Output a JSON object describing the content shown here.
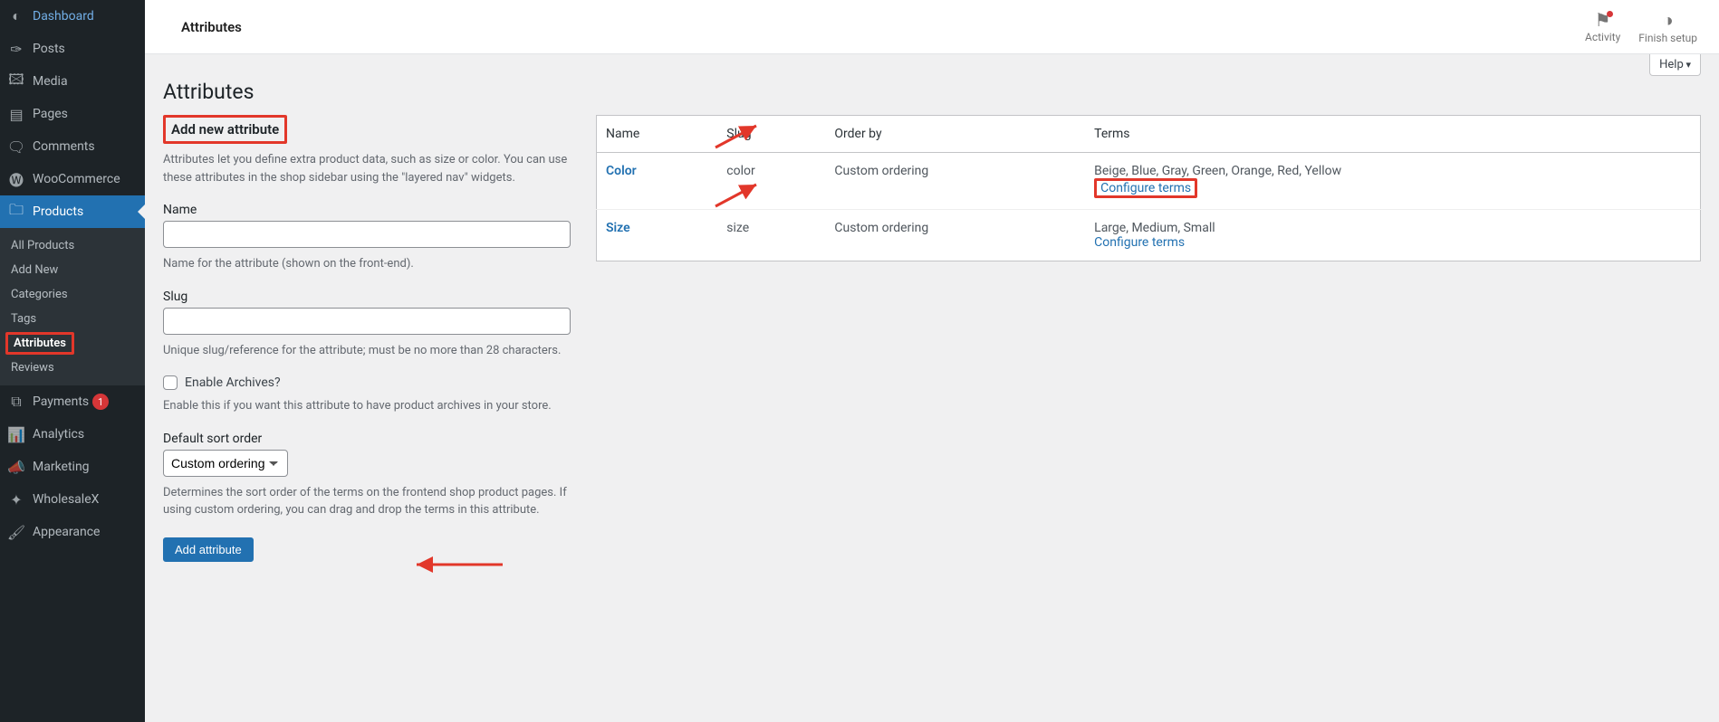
{
  "sidebar": {
    "items": [
      {
        "label": "Dashboard",
        "icon": "◐"
      },
      {
        "label": "Posts",
        "icon": "✑"
      },
      {
        "label": "Media",
        "icon": "🖾"
      },
      {
        "label": "Pages",
        "icon": "▤"
      },
      {
        "label": "Comments",
        "icon": "🗨"
      },
      {
        "label": "WooCommerce",
        "icon": "🅦"
      },
      {
        "label": "Products",
        "icon": "🗀",
        "current": true
      },
      {
        "label": "Payments",
        "icon": "⧉",
        "badge": "1"
      },
      {
        "label": "Analytics",
        "icon": "📊"
      },
      {
        "label": "Marketing",
        "icon": "📣"
      },
      {
        "label": "WholesaleX",
        "icon": "✦"
      },
      {
        "label": "Appearance",
        "icon": "🖌"
      }
    ],
    "submenu": [
      {
        "label": "All Products"
      },
      {
        "label": "Add New"
      },
      {
        "label": "Categories"
      },
      {
        "label": "Tags"
      },
      {
        "label": "Attributes",
        "active": true
      },
      {
        "label": "Reviews"
      }
    ]
  },
  "topbar": {
    "title": "Attributes",
    "activity": "Activity",
    "finish": "Finish setup"
  },
  "page": {
    "help": "Help",
    "heading": "Attributes",
    "add_heading": "Add new attribute",
    "intro": "Attributes let you define extra product data, such as size or color. You can use these attributes in the shop sidebar using the \"layered nav\" widgets.",
    "name_label": "Name",
    "name_help": "Name for the attribute (shown on the front-end).",
    "slug_label": "Slug",
    "slug_help": "Unique slug/reference for the attribute; must be no more than 28 characters.",
    "archives_label": "Enable Archives?",
    "archives_help": "Enable this if you want this attribute to have product archives in your store.",
    "sort_label": "Default sort order",
    "sort_value": "Custom ordering",
    "sort_help": "Determines the sort order of the terms on the frontend shop product pages. If using custom ordering, you can drag and drop the terms in this attribute.",
    "add_btn": "Add attribute"
  },
  "table": {
    "headers": {
      "name": "Name",
      "slug": "Slug",
      "order": "Order by",
      "terms": "Terms"
    },
    "configure": "Configure terms",
    "rows": [
      {
        "name": "Color",
        "slug": "color",
        "order": "Custom ordering",
        "terms": "Beige, Blue, Gray, Green, Orange, Red, Yellow",
        "hl": true
      },
      {
        "name": "Size",
        "slug": "size",
        "order": "Custom ordering",
        "terms": "Large, Medium, Small"
      }
    ]
  }
}
